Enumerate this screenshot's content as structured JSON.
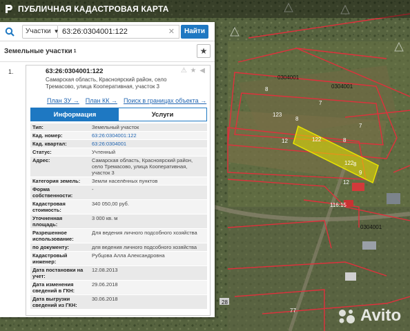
{
  "app": {
    "title": "ПУБЛИЧНАЯ КАДАСТРОВАЯ КАРТА"
  },
  "search": {
    "scope": "Участки",
    "query": "63:26:0304001:122",
    "find_label": "Найти"
  },
  "section": {
    "title": "Земельные участки",
    "count": "1"
  },
  "card": {
    "index": "1.",
    "cad_number": "63:26:0304001:122",
    "address": "Самарская область, Красноярский район, село Тремасово, улица Кооперативная, участок 3",
    "links": [
      "План ЗУ →",
      "План КК →",
      "Поиск в границах объекта →"
    ],
    "tabs": [
      "Информация",
      "Услуги"
    ],
    "rows": [
      {
        "k": "Тип:",
        "v": "Земельный участок"
      },
      {
        "k": "Кад. номер:",
        "v": "63:26:0304001:122"
      },
      {
        "k": "Кад. квартал:",
        "v": "63:26:0304001"
      },
      {
        "k": "Статус:",
        "v": "Учтенный"
      },
      {
        "k": "Адрес:",
        "v": "Самарская область, Красноярский район, село Тремасово, улица Кооперативная, участок 3"
      },
      {
        "k": "Категория земель:",
        "v": "Земли населённых пунктов"
      },
      {
        "k": "Форма собственности:",
        "v": "-"
      },
      {
        "k": "Кадастровая стоимость:",
        "v": "340 050,00 руб."
      },
      {
        "k": "Уточненная площадь:",
        "v": "3 000 кв. м"
      },
      {
        "k": "Разрешенное использование:",
        "v": "Для ведения личного подсобного хозяйства"
      },
      {
        "k": "по документу:",
        "v": "для ведения личного подсобного хозяйства"
      },
      {
        "k": "Кадастровый инженер:",
        "v": "Рубцова Алла Александровна"
      },
      {
        "k": "Дата постановки на учет:",
        "v": "12.08.2013"
      },
      {
        "k": "Дата изменения сведений в ГКН:",
        "v": "29.06.2018"
      },
      {
        "k": "Дата выгрузки сведений из ГКН:",
        "v": "30.06.2018"
      }
    ]
  },
  "map": {
    "labels": [
      "0304001",
      "0304001",
      "0304001",
      "8",
      "7",
      "8",
      "7",
      "123",
      "8",
      "12",
      "122",
      "122",
      "8",
      "9",
      "12",
      "116:15",
      "28",
      "77"
    ],
    "selected_color": "#e8e400",
    "boundary_color": "#e0303c"
  },
  "watermark": {
    "word": "Avito"
  }
}
